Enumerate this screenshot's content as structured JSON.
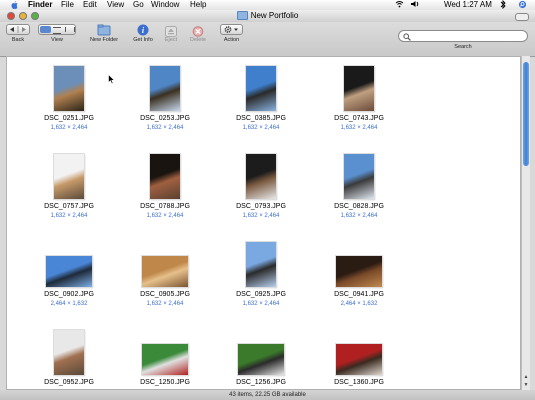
{
  "menubar": {
    "app": "Finder",
    "items": [
      "File",
      "Edit",
      "View",
      "Go",
      "Window",
      "Help"
    ],
    "clock": "Wed 1:27 AM"
  },
  "window": {
    "title": "New Portfolio"
  },
  "toolbar": {
    "back": "Back",
    "view": "View",
    "new_folder": "New Folder",
    "get_info": "Get Info",
    "eject": "Eject",
    "delete": "Delete",
    "action": "Action",
    "search": "Search"
  },
  "files": [
    {
      "name": "DSC_0251.JPG",
      "dims": "1,632 × 2,464",
      "orient": "p",
      "palette": [
        "#6b8fb8",
        "#2b2419",
        "#b08050"
      ]
    },
    {
      "name": "DSC_0253.JPG",
      "dims": "1,632 × 2,464",
      "orient": "p",
      "palette": [
        "#4f86c6",
        "#c8d9ef",
        "#3a3020"
      ]
    },
    {
      "name": "DSC_0385.JPG",
      "dims": "1,632 × 2,464",
      "orient": "p",
      "palette": [
        "#3f7fcc",
        "#8ab3e0",
        "#2a2a2a"
      ]
    },
    {
      "name": "DSC_0743.JPG",
      "dims": "1,632 × 2,464",
      "orient": "p",
      "palette": [
        "#1a1a1a",
        "#6a4a3a",
        "#c0a080"
      ]
    },
    {
      "name": "DSC_0757.JPG",
      "dims": "1,632 × 2,464",
      "orient": "p",
      "palette": [
        "#f2f2f2",
        "#5a4a3a",
        "#c69a6a"
      ]
    },
    {
      "name": "DSC_0788.JPG",
      "dims": "1,632 × 2,464",
      "orient": "p",
      "palette": [
        "#1a1410",
        "#5a4030",
        "#a06040"
      ]
    },
    {
      "name": "DSC_0793.JPG",
      "dims": "1,632 × 2,464",
      "orient": "p",
      "palette": [
        "#1c1c1c",
        "#e8e8e8",
        "#7a5a40"
      ]
    },
    {
      "name": "DSC_0828.JPG",
      "dims": "1,632 × 2,464",
      "orient": "p",
      "palette": [
        "#5a8fd0",
        "#e0e8f2",
        "#3a3a3a"
      ]
    },
    {
      "name": "DSC_0902.JPG",
      "dims": "2,464 × 1,632",
      "orient": "l",
      "palette": [
        "#4a86d6",
        "#7fb0e8",
        "#1e2a3a"
      ]
    },
    {
      "name": "DSC_0905.JPG",
      "dims": "1,632 × 2,464",
      "orient": "l",
      "palette": [
        "#c0874a",
        "#7a5432",
        "#e6c08a"
      ]
    },
    {
      "name": "DSC_0925.JPG",
      "dims": "1,632 × 2,464",
      "orient": "p",
      "palette": [
        "#7aa8e0",
        "#b8d0f0",
        "#2a2a2a"
      ]
    },
    {
      "name": "DSC_0941.JPG",
      "dims": "2,464 × 1,632",
      "orient": "l",
      "palette": [
        "#2a1c12",
        "#c08a50",
        "#7a4a2a"
      ]
    },
    {
      "name": "DSC_0952.JPG",
      "dims": "1,632 × 2,464",
      "orient": "p",
      "palette": [
        "#e8e8e8",
        "#5a4a3a",
        "#a07050"
      ]
    },
    {
      "name": "DSC_1250.JPG",
      "dims": "",
      "orient": "l",
      "palette": [
        "#3a8a3a",
        "#b02020",
        "#e0e0e0"
      ]
    },
    {
      "name": "DSC_1256.JPG",
      "dims": "",
      "orient": "l",
      "palette": [
        "#3a7a2a",
        "#e8e8e8",
        "#2a2a2a"
      ]
    },
    {
      "name": "DSC_1360.JPG",
      "dims": "",
      "orient": "l",
      "palette": [
        "#b02020",
        "#e0d8d0",
        "#3a2a20"
      ]
    }
  ],
  "status": "43 items, 22.25 GB available"
}
